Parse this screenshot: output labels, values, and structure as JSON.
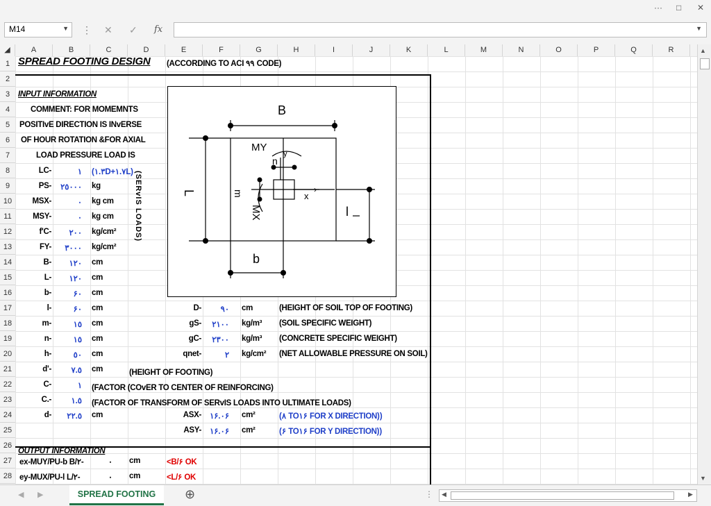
{
  "window": {
    "dots": "···",
    "restore": "□",
    "close": "✕"
  },
  "namebox": {
    "value": "M14"
  },
  "formula": {
    "fx": "fx",
    "cancel": "✕",
    "enter": "✓",
    "value": ""
  },
  "columns": [
    "A",
    "B",
    "C",
    "D",
    "E",
    "F",
    "G",
    "H",
    "I",
    "J",
    "K",
    "L",
    "M",
    "N",
    "O",
    "P",
    "Q",
    "R"
  ],
  "rows": [
    "1",
    "2",
    "3",
    "4",
    "5",
    "6",
    "7",
    "8",
    "9",
    "10",
    "11",
    "12",
    "13",
    "14",
    "15",
    "16",
    "17",
    "18",
    "19",
    "20",
    "21",
    "22",
    "23",
    "24",
    "25",
    "26",
    "27",
    "28"
  ],
  "sheet": {
    "title": "SPREAD FOOTING DESIGN",
    "subtitle": "(ACCORDING TO ACI ٩٩ CODE)",
    "input_header": "INPUT INFORMATION",
    "comment": [
      "COMMENT: FOR MOMEMNTS",
      "POSITIvE DIRECTION IS  INvERSE",
      "OF HOUR ROTATION &FOR AXIAL",
      "LOAD PRESSURE LOAD IS"
    ],
    "servis_loads": "(SERvIS LOADS)",
    "params": [
      {
        "label": "LC-",
        "value": "١",
        "unit": "(١.٣D+١.٧L)",
        "unit_blue": true
      },
      {
        "label": "PS-",
        "value": "٢٥٠٠٠",
        "unit": "kg"
      },
      {
        "label": "MSX-",
        "value": "٠",
        "unit": "kg cm"
      },
      {
        "label": "MSY-",
        "value": "٠",
        "unit": "kg cm"
      },
      {
        "label": "f'C-",
        "value": "٢٠٠",
        "unit": "kg/cm²"
      },
      {
        "label": "FY-",
        "value": "٣٠٠٠",
        "unit": "kg/cm²"
      },
      {
        "label": "B-",
        "value": "١٢٠",
        "unit": "cm"
      },
      {
        "label": "L-",
        "value": "١٢٠",
        "unit": "cm"
      },
      {
        "label": "b-",
        "value": "۶٠",
        "unit": "cm"
      },
      {
        "label": "l-",
        "value": "۶٠",
        "unit": "cm"
      },
      {
        "label": "m-",
        "value": "١٥",
        "unit": "cm"
      },
      {
        "label": "n-",
        "value": "١٥",
        "unit": "cm"
      },
      {
        "label": "h-",
        "value": "٥٠",
        "unit": "cm"
      },
      {
        "label": "d'-",
        "value": "٧.٥",
        "unit": "cm"
      },
      {
        "label": "C-",
        "value": "١",
        "unit": ""
      },
      {
        "label": "C.-",
        "value": "١.٥",
        "unit": ""
      },
      {
        "label": "d-",
        "value": "٢٢.٥",
        "unit": "cm"
      }
    ],
    "notes": {
      "h_note": "(HEIGHT OF FOOTING)",
      "c_note": "(FACTOR (COvER TO CENTER OF REINFORCING)",
      "c2_note": "(FACTOR OF TRANSFORM OF SERvIS LOADS INTO ULTIMATE  LOADS)"
    },
    "right_params": [
      {
        "label": "D-",
        "value": "٩٠",
        "unit": "cm",
        "note": "(HEIGHT OF SOIL TOP OF FOOTING)"
      },
      {
        "label": "gS-",
        "value": "٢١٠٠",
        "unit": "kg/m³",
        "note": "(SOIL SPECIFIC WEIGHT)"
      },
      {
        "label": "gC-",
        "value": "٢٣٠٠",
        "unit": "kg/m³",
        "note": "(CONCRETE SPECIFIC WEIGHT)"
      },
      {
        "label": "qnet-",
        "value": "٢",
        "unit": "kg/cm²",
        "note": "(NET ALLOWABLE PRESSURE ON SOIL)"
      }
    ],
    "steel": [
      {
        "label": "ASX-",
        "value": "١۶.٠۶",
        "unit": "cm²",
        "note": "(٨ TO١۶ FOR X DIRECTION))"
      },
      {
        "label": "ASY-",
        "value": "١۶.٠۶",
        "unit": "cm²",
        "note": "(۶ TO١۶ FOR Y DIRECTION))"
      }
    ],
    "output_header": "OUTPUT INFORMATION",
    "outputs": [
      {
        "label": "ex-MUY/PU-b B/٢-",
        "value": "٠",
        "unit": "cm",
        "check": "<B/۶ OK"
      },
      {
        "label": "ey-MUX/PU-l L/٢-",
        "value": "٠",
        "unit": "cm",
        "check": "<L/۶ OK"
      }
    ],
    "diagram": {
      "B": "B",
      "L": "L",
      "b": "b",
      "l": "l",
      "m": "m",
      "n": "n",
      "MX": "MX",
      "MY": "MY",
      "x": "x",
      "y": "y"
    }
  },
  "tabs": {
    "active": "SPREAD FOOTING",
    "add": "⊕"
  }
}
